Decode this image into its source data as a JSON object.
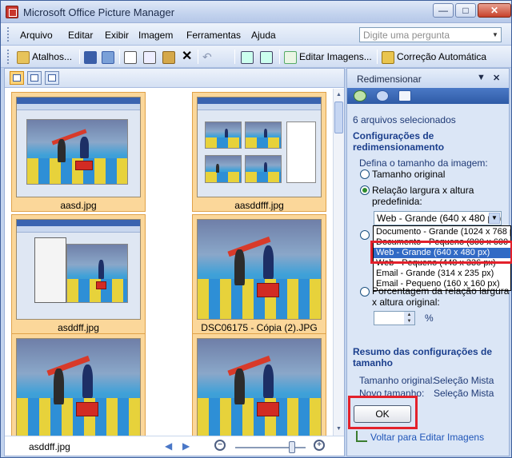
{
  "window": {
    "title": "Microsoft Office Picture Manager",
    "min_glyph": "—",
    "max_glyph": "□",
    "close_glyph": "✕"
  },
  "menu": {
    "items": [
      "Arquivo",
      "Editar",
      "Exibir",
      "Imagem",
      "Ferramentas",
      "Ajuda"
    ],
    "ask_placeholder": "Digite uma pergunta"
  },
  "toolbar": {
    "shortcuts_label": "Atalhos...",
    "edit_images_label": "Editar Imagens...",
    "auto_correct_label": "Correção Automática"
  },
  "thumbnails": [
    {
      "caption": "aasd.jpg",
      "kind": "screenshot"
    },
    {
      "caption": "aasddfff.jpg",
      "kind": "screenshot-grid"
    },
    {
      "caption": "asddff.jpg",
      "kind": "screenshot-menu"
    },
    {
      "caption": "DSC06175 - Cópia (2).JPG",
      "kind": "photo"
    },
    {
      "caption": "",
      "kind": "photo"
    },
    {
      "caption": "",
      "kind": "photo"
    }
  ],
  "status": {
    "current_file": "asddff.jpg",
    "zoom_out_glyph": "−",
    "zoom_in_glyph": "+"
  },
  "taskpane": {
    "title": "Redimensionar",
    "selected_count": "6 arquivos selecionados",
    "settings_heading": "Configurações de redimensionamento",
    "size_prompt": "Defina o tamanho da imagem:",
    "opt_original": "Tamanho original",
    "opt_ratio_1": "Relação largura x altura",
    "opt_ratio_2": "predefinida:",
    "combo_value": "Web - Grande (640 x 480 px)",
    "dropdown_options": [
      "Documento - Grande (1024 x 768 px)",
      "Documento - Pequeno (800 x 600 px)",
      "Web - Grande (640 x 480 px)",
      "Web - Pequeno (448 x 336 px)",
      "Email - Grande (314 x 235 px)",
      "Email - Pequeno (160 x 160 px)"
    ],
    "dropdown_selected_index": 2,
    "opt_percent_1": "Porcentagem da relação largura",
    "opt_percent_2": "x altura original:",
    "percent_unit": "%",
    "summary_heading": "Resumo das configurações de tamanho",
    "orig_size_label": "Tamanho original:",
    "orig_size_value": "Seleção Mista",
    "new_size_label": "Novo tamanho:",
    "new_size_value": "Seleção Mista",
    "ok_label": "OK",
    "back_link": "Voltar para Editar Imagens"
  },
  "colors": {
    "highlight": "#e3212b",
    "selection": "#316ac5",
    "thumb_frame": "#fbd79a"
  }
}
